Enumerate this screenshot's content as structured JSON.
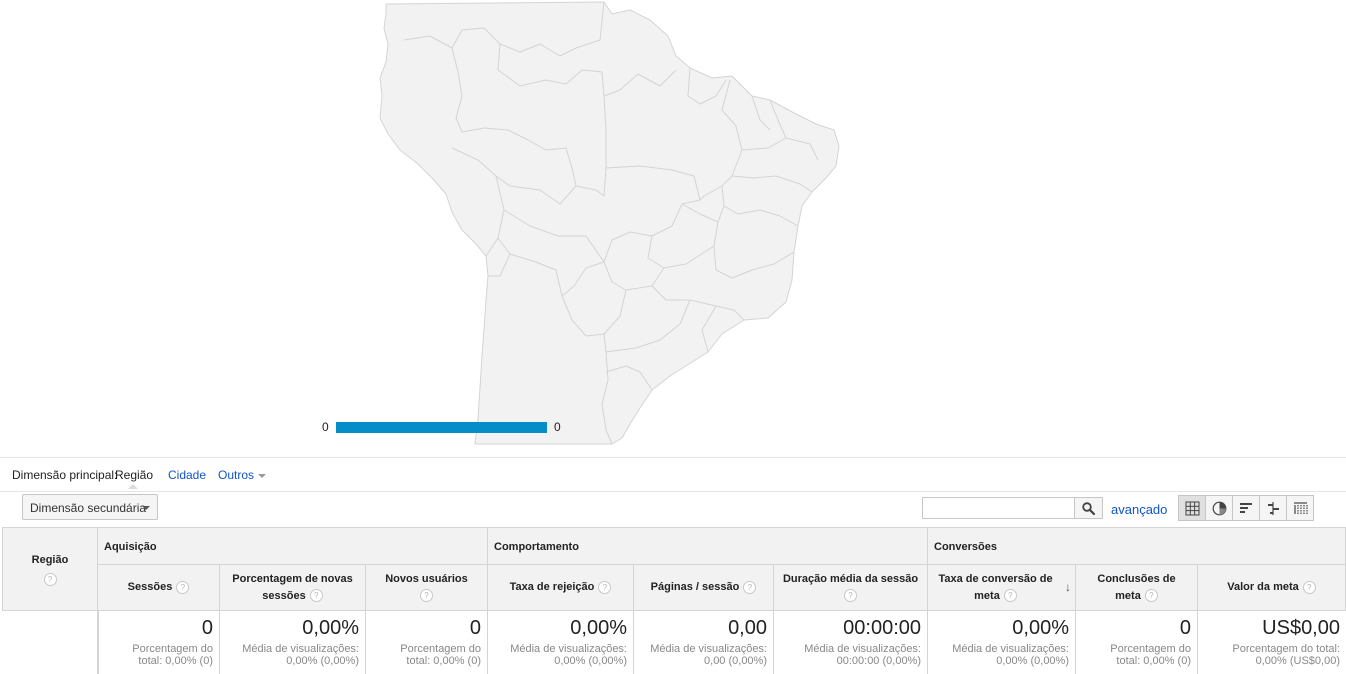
{
  "map": {
    "legend_min": "0",
    "legend_max": "0",
    "legend_color": "#058dc7",
    "land_color": "#f2f2f2",
    "border_color": "#d4d4d4"
  },
  "dimension_bar": {
    "label": "Dimensão principal:",
    "active": "Região",
    "links": [
      "Cidade",
      "Outros"
    ]
  },
  "toolbar": {
    "secondary_dimension": "Dimensão secundária",
    "search_placeholder": "",
    "search_icon": "search-icon",
    "advanced": "avançado",
    "view_icons": [
      "table-view-icon",
      "pie-view-icon",
      "performance-view-icon",
      "comparison-view-icon",
      "pivot-view-icon"
    ]
  },
  "table": {
    "row_header": "Região",
    "groups": [
      "Aquisição",
      "Comportamento",
      "Conversões"
    ],
    "columns": [
      "Sessões",
      "Porcentagem de novas sessões",
      "Novos usuários",
      "Taxa de rejeição",
      "Páginas / sessão",
      "Duração média da sessão",
      "Taxa de conversão de meta",
      "Conclusões de meta",
      "Valor da meta"
    ],
    "totals": [
      {
        "value": "0",
        "line1": "Porcentagem do",
        "line2": "total: 0,00% (0)"
      },
      {
        "value": "0,00%",
        "line1": "Média de visualizações:",
        "line2": "0,00% (0,00%)"
      },
      {
        "value": "0",
        "line1": "Porcentagem do",
        "line2": "total: 0,00% (0)"
      },
      {
        "value": "0,00%",
        "line1": "Média de visualizações:",
        "line2": "0,00% (0,00%)"
      },
      {
        "value": "0,00",
        "line1": "Média de visualizações:",
        "line2": "0,00 (0,00%)"
      },
      {
        "value": "00:00:00",
        "line1": "Média de visualizações:",
        "line2": "00:00:00 (0,00%)"
      },
      {
        "value": "0,00%",
        "line1": "Média de visualizações:",
        "line2": "0,00% (0,00%)"
      },
      {
        "value": "0",
        "line1": "Porcentagem do",
        "line2": "total: 0,00% (0)"
      },
      {
        "value": "US$0,00",
        "line1": "Porcentagem do total:",
        "line2": "0,00% (US$0,00)"
      }
    ]
  }
}
